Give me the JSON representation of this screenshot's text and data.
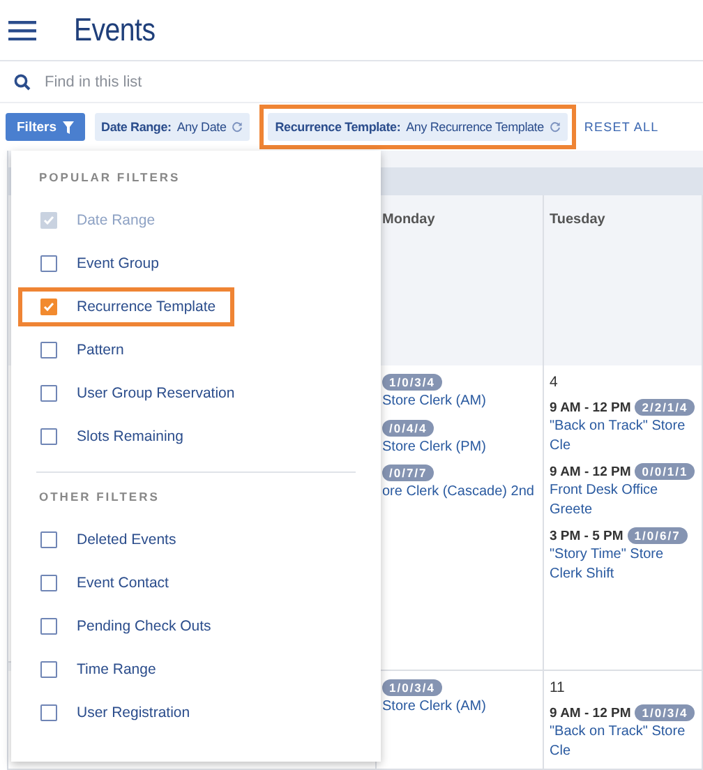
{
  "header": {
    "title": "Events"
  },
  "search": {
    "placeholder": "Find in this list"
  },
  "filter_bar": {
    "filters_button": "Filters",
    "chips": [
      {
        "label": "Date Range:",
        "value": "Any Date",
        "highlighted": false
      },
      {
        "label": "Recurrence Template:",
        "value": "Any Recurrence Template",
        "highlighted": true
      }
    ],
    "reset_all": "RESET ALL"
  },
  "filter_menu": {
    "sections": [
      {
        "title": "POPULAR FILTERS",
        "items": [
          {
            "label": "Date Range",
            "checked": true,
            "disabled": true,
            "highlighted": false
          },
          {
            "label": "Event Group",
            "checked": false,
            "disabled": false,
            "highlighted": false
          },
          {
            "label": "Recurrence Template",
            "checked": true,
            "disabled": false,
            "highlighted": true
          },
          {
            "label": "Pattern",
            "checked": false,
            "disabled": false,
            "highlighted": false
          },
          {
            "label": "User Group Reservation",
            "checked": false,
            "disabled": false,
            "highlighted": false
          },
          {
            "label": "Slots Remaining",
            "checked": false,
            "disabled": false,
            "highlighted": false
          }
        ]
      },
      {
        "title": "OTHER FILTERS",
        "items": [
          {
            "label": "Deleted Events",
            "checked": false,
            "disabled": false,
            "highlighted": false
          },
          {
            "label": "Event Contact",
            "checked": false,
            "disabled": false,
            "highlighted": false
          },
          {
            "label": "Pending Check Outs",
            "checked": false,
            "disabled": false,
            "highlighted": false
          },
          {
            "label": "Time Range",
            "checked": false,
            "disabled": false,
            "highlighted": false
          },
          {
            "label": "User Registration",
            "checked": false,
            "disabled": false,
            "highlighted": false
          }
        ]
      }
    ]
  },
  "calendar": {
    "columns": [
      "Monday",
      "Tuesday"
    ],
    "weeks": [
      {
        "days": [
          {
            "events": [
              {
                "badge": "1/0/3/4",
                "title": "Store Clerk (AM)"
              },
              {
                "badge": "/0/4/4",
                "title": "Store Clerk (PM)"
              },
              {
                "badge": "/0/7/7",
                "title": "ore Clerk (Cascade) 2nd"
              }
            ]
          },
          {
            "number": "4",
            "events": [
              {
                "time": "9 AM - 12 PM",
                "badge": "2/2/1/4",
                "title": "\"Back on Track\" Store Cle"
              },
              {
                "time": "9 AM - 12 PM",
                "badge": "0/0/1/1",
                "title": "Front Desk Office Greete"
              },
              {
                "time": "3 PM - 5 PM",
                "badge": "1/0/6/7",
                "title": "\"Story Time\" Store Clerk Shift"
              }
            ]
          }
        ]
      },
      {
        "days": [
          {
            "events": [
              {
                "badge": "1/0/3/4",
                "title": "Store Clerk (AM)"
              }
            ]
          },
          {
            "number": "11",
            "events": [
              {
                "time": "9 AM - 12 PM",
                "badge": "1/0/3/4",
                "title": "\"Back on Track\" Store Cle"
              }
            ]
          }
        ]
      }
    ]
  }
}
